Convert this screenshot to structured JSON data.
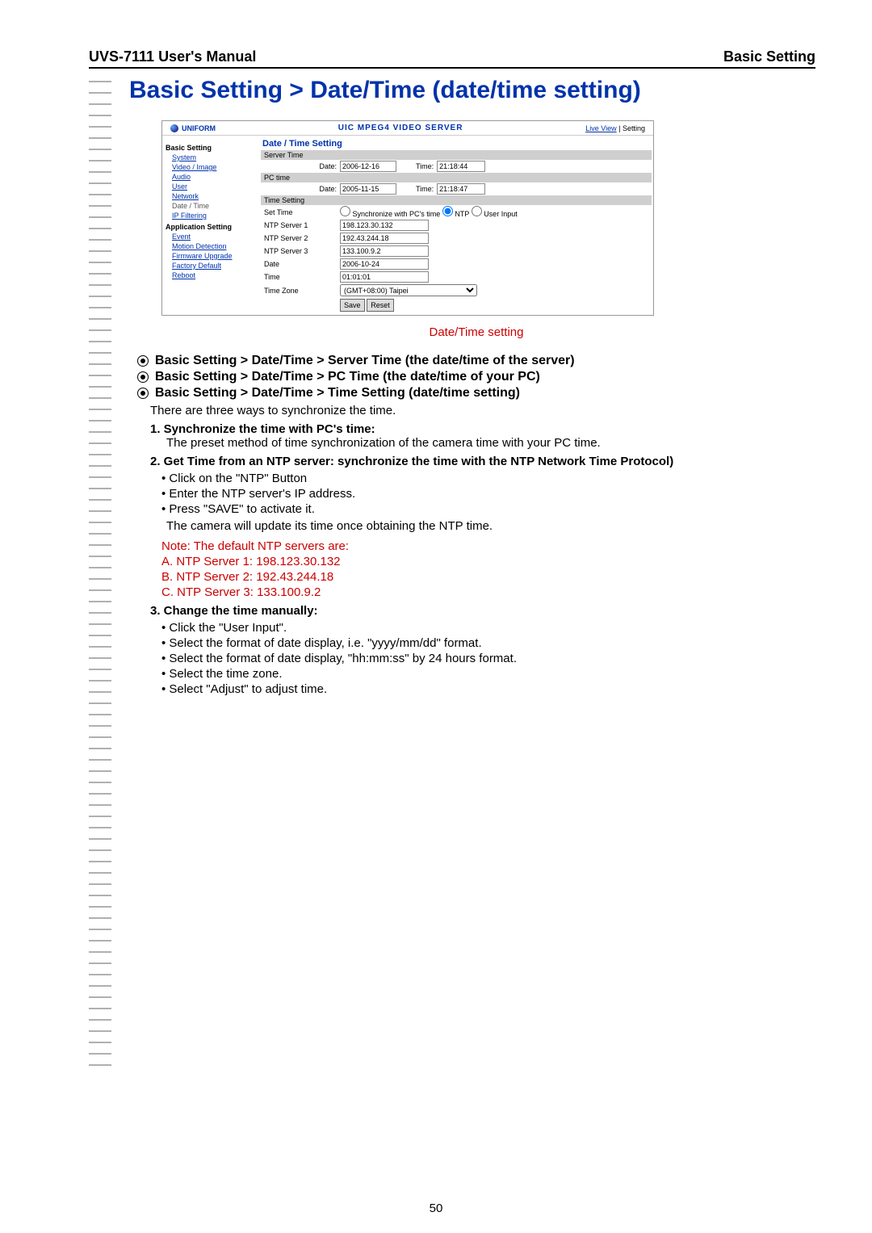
{
  "header": {
    "left": "UVS-7111 User's Manual",
    "right": "Basic Setting"
  },
  "page_title": "Basic Setting > Date/Time (date/time setting)",
  "screenshot": {
    "logo": "UNIFORM",
    "title": "UIC MPEG4 VIDEO SERVER",
    "links": {
      "live_view": "Live View",
      "setting": "Setting"
    },
    "sidebar": {
      "section1": "Basic Setting",
      "items1": [
        "System",
        "Video / Image",
        "Audio",
        "User",
        "Network"
      ],
      "current": "Date / Time",
      "items1b": [
        "IP Filtering"
      ],
      "section2": "Application Setting",
      "items2": [
        "Event",
        "Motion Detection",
        "Firmware Upgrade",
        "Factory Default",
        "Reboot"
      ]
    },
    "panel_title": "Date / Time Setting",
    "server_time_header": "Server Time",
    "server_date_label": "Date:",
    "server_date": "2006-12-16",
    "server_time_label": "Time:",
    "server_time": "21:18:44",
    "pc_time_header": "PC time",
    "pc_date": "2005-11-15",
    "pc_time": "21:18:47",
    "time_setting_header": "Time Setting",
    "set_time_label": "Set Time",
    "radio_sync": "Synchronize with PC's time",
    "radio_ntp": "NTP",
    "radio_user": "User Input",
    "ntp1_label": "NTP Server 1",
    "ntp1": "198.123.30.132",
    "ntp2_label": "NTP Server 2",
    "ntp2": "192.43.244.18",
    "ntp3_label": "NTP Server 3",
    "ntp3": "133.100.9.2",
    "date_label": "Date",
    "date_val": "2006-10-24",
    "time_label": "Time",
    "time_val": "01:01:01",
    "tz_label": "Time Zone",
    "tz_val": "(GMT+08:00) Taipei",
    "save_btn": "Save",
    "reset_btn": "Reset"
  },
  "caption": "Date/Time setting",
  "bullets": [
    "Basic Setting > Date/Time > Server Time (the date/time of the server)",
    "Basic Setting > Date/Time > PC Time (the date/time of your PC)",
    "Basic Setting > Date/Time > Time Setting (date/time setting)"
  ],
  "intro": "There are three ways to synchronize the time.",
  "num1_head": "1.  Synchronize the time with PC's time:",
  "num1_body": "The preset method of time synchronization of the camera time with your PC time.",
  "num2_head": "2.  Get Time from an NTP server: synchronize the time with the NTP Network Time Protocol)",
  "num2_bullets": [
    "Click on the \"NTP\" Button",
    "Enter the NTP server's IP address.",
    "Press \"SAVE\" to activate it."
  ],
  "num2_after": "The camera will update its time once obtaining the NTP time.",
  "red_note_head": "Note: The default NTP servers are:",
  "red_notes": [
    "A. NTP Server 1: 198.123.30.132",
    "B. NTP Server 2: 192.43.244.18",
    "C. NTP Server 3: 133.100.9.2"
  ],
  "num3_head": "3.  Change the time manually:",
  "num3_bullets": [
    "Click the \"User Input\".",
    "Select the format of date display, i.e. \"yyyy/mm/dd\" format.",
    "Select the format of date display, \"hh:mm:ss\" by 24 hours format.",
    "Select the time zone.",
    "Select \"Adjust\" to adjust time."
  ],
  "page_number": "50"
}
